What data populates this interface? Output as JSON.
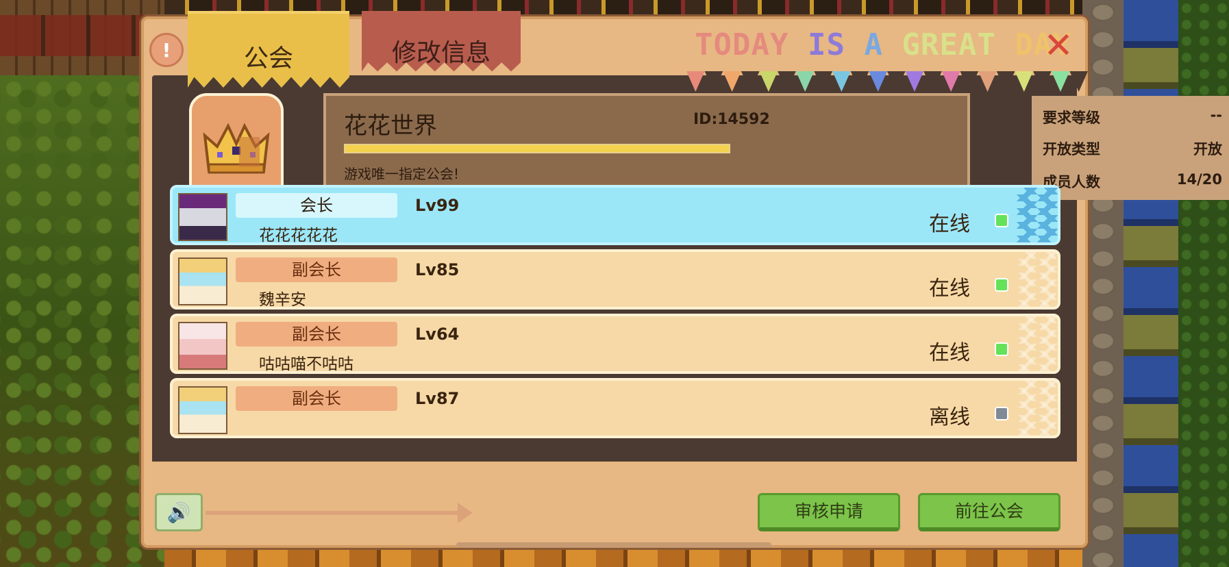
{
  "tabs": {
    "guild": "公会",
    "edit": "修改信息"
  },
  "banner": {
    "words": [
      {
        "text": "TODAY",
        "color": "#e58a7e"
      },
      {
        "text": "IS",
        "color": "#8e7ad8"
      },
      {
        "text": "A",
        "color": "#7aa8e0"
      },
      {
        "text": "GREAT",
        "color": "#d9e08a"
      },
      {
        "text": "DAY",
        "color": "#f0c26a"
      }
    ],
    "bunting_colors": [
      "#e88a7a",
      "#f0a86a",
      "#c9d66a",
      "#8ad6a8",
      "#7ac6e0",
      "#6a8ae0",
      "#a07ae0",
      "#e07aa8",
      "#e0a07a",
      "#d8e07a",
      "#8ae0a0"
    ]
  },
  "guild": {
    "name": "花花世界",
    "id": "ID:14592",
    "exp_progress": 1.0,
    "description": "游戏唯一指定公会!",
    "info": [
      {
        "label": "要求等级",
        "value": "--"
      },
      {
        "label": "开放类型",
        "value": "开放"
      },
      {
        "label": "成员人数",
        "value": "14/20"
      }
    ]
  },
  "members": [
    {
      "role": "会长",
      "name": "花花花花花",
      "level": "Lv99",
      "status": "在线",
      "online": true,
      "avatar": "purple-hair-avatar",
      "avatar_color": "#b04ab8",
      "leader": true
    },
    {
      "role": "副会长",
      "name": "魏辛安",
      "level": "Lv85",
      "status": "在线",
      "online": true,
      "avatar": "blonde-goddess-avatar",
      "avatar_color": "#a9e2f0",
      "leader": false
    },
    {
      "role": "副会长",
      "name": "咕咕喵不咕咕",
      "level": "Lv64",
      "status": "在线",
      "online": true,
      "avatar": "white-cat-avatar",
      "avatar_color": "#f3c6c6",
      "leader": false
    },
    {
      "role": "副会长",
      "name": "",
      "level": "Lv87",
      "status": "离线",
      "online": false,
      "avatar": "blonde-goddess-avatar",
      "avatar_color": "#a9e2f0",
      "leader": false
    }
  ],
  "footer": {
    "review_button": "审核申请",
    "goto_button": "前往公会"
  },
  "colors": {
    "accent_gold": "#e9bf4a",
    "online": "#64e25a",
    "offline": "#7f8a95",
    "button_green": "#7cc44a"
  }
}
